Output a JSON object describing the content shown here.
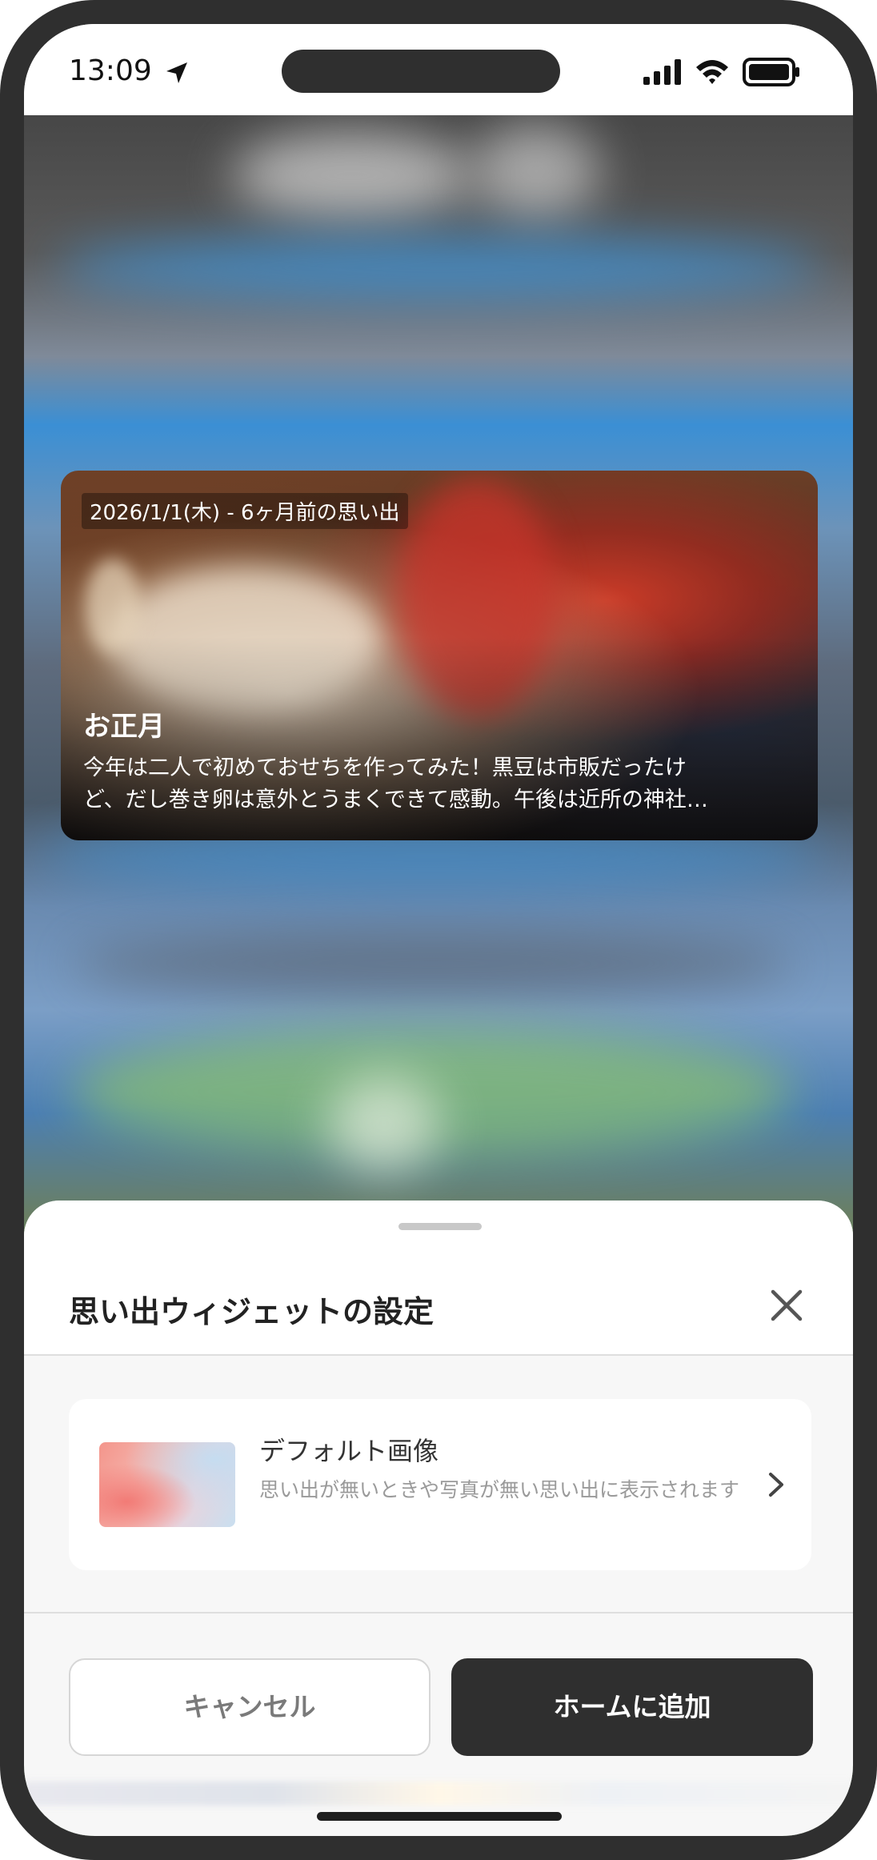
{
  "status_bar": {
    "time": "13:09",
    "icons": [
      "location-arrow-icon",
      "cellular-signal-icon",
      "wifi-icon",
      "battery-icon"
    ]
  },
  "memory_card": {
    "date": "2026/1/1(木) - 6ヶ月前の思い出",
    "title": "お正月",
    "body_line1": "今年は二人で初めておせちを作ってみた！黒豆は市販だったけ",
    "body_line2": "ど、だし巻き卵は意外とうまくできて感動。午後は近所の神社…"
  },
  "sheet": {
    "title": "思い出ウィジェットの設定",
    "close_icon": "close-icon",
    "option": {
      "title": "デフォルト画像",
      "description": "思い出が無いときや写真が無い思い出に表示されます",
      "icon": "chevron-right-icon"
    },
    "cancel_label": "キャンセル",
    "add_label": "ホームに追加"
  },
  "colors": {
    "frame": "#2f2f2f",
    "primary_button": "#2f2f2f",
    "sheet_background": "#f7f7f7"
  }
}
